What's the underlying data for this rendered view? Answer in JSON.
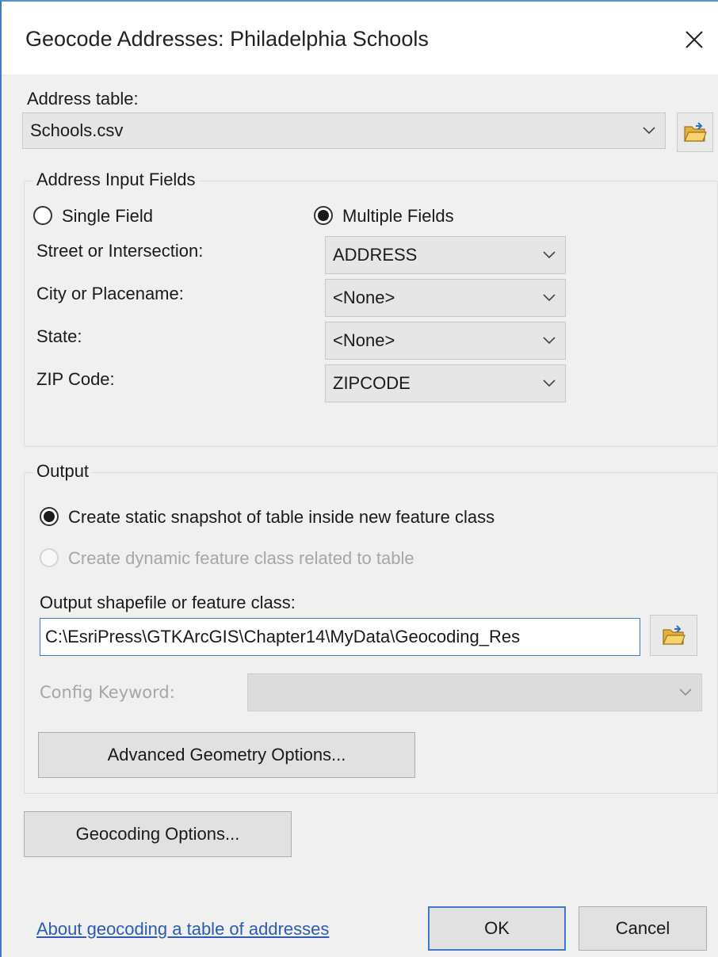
{
  "dialog": {
    "title": "Geocode Addresses:  Philadelphia Schools",
    "close_glyph": "✕"
  },
  "address_table": {
    "label": "Address table:",
    "value": "Schools.csv"
  },
  "address_input": {
    "group_title": "Address Input Fields",
    "single_field_label": "Single Field",
    "multiple_fields_label": "Multiple Fields",
    "selected_mode": "Multiple Fields",
    "fields": [
      {
        "label": "Street or Intersection:",
        "value": "ADDRESS"
      },
      {
        "label": "City or Placename:",
        "value": "<None>"
      },
      {
        "label": "State:",
        "value": "<None>"
      },
      {
        "label": "ZIP Code:",
        "value": "ZIPCODE"
      }
    ]
  },
  "output": {
    "group_title": "Output",
    "static_label": "Create static snapshot of table inside new feature class",
    "dynamic_label": "Create dynamic feature class related to table",
    "selected_option": "static",
    "path_label": "Output shapefile or feature class:",
    "path_value": "C:\\EsriPress\\GTKArcGIS\\Chapter14\\MyData\\Geocoding_Res",
    "config_keyword_label": "Config Keyword:",
    "config_keyword_value": "",
    "advanced_button": "Advanced Geometry Options..."
  },
  "footer": {
    "geocoding_options_button": "Geocoding Options...",
    "help_link": "About geocoding a table of addresses",
    "ok_button": "OK",
    "cancel_button": "Cancel"
  },
  "icons": {
    "folder": "folder-open-icon",
    "chevron": "chevron-down-icon",
    "close": "close-icon"
  },
  "colors": {
    "accent": "#3b7cc4",
    "link": "#2a5db0",
    "dialog_background": "#f0f0f0",
    "disabled_text": "#a6a6a6"
  }
}
